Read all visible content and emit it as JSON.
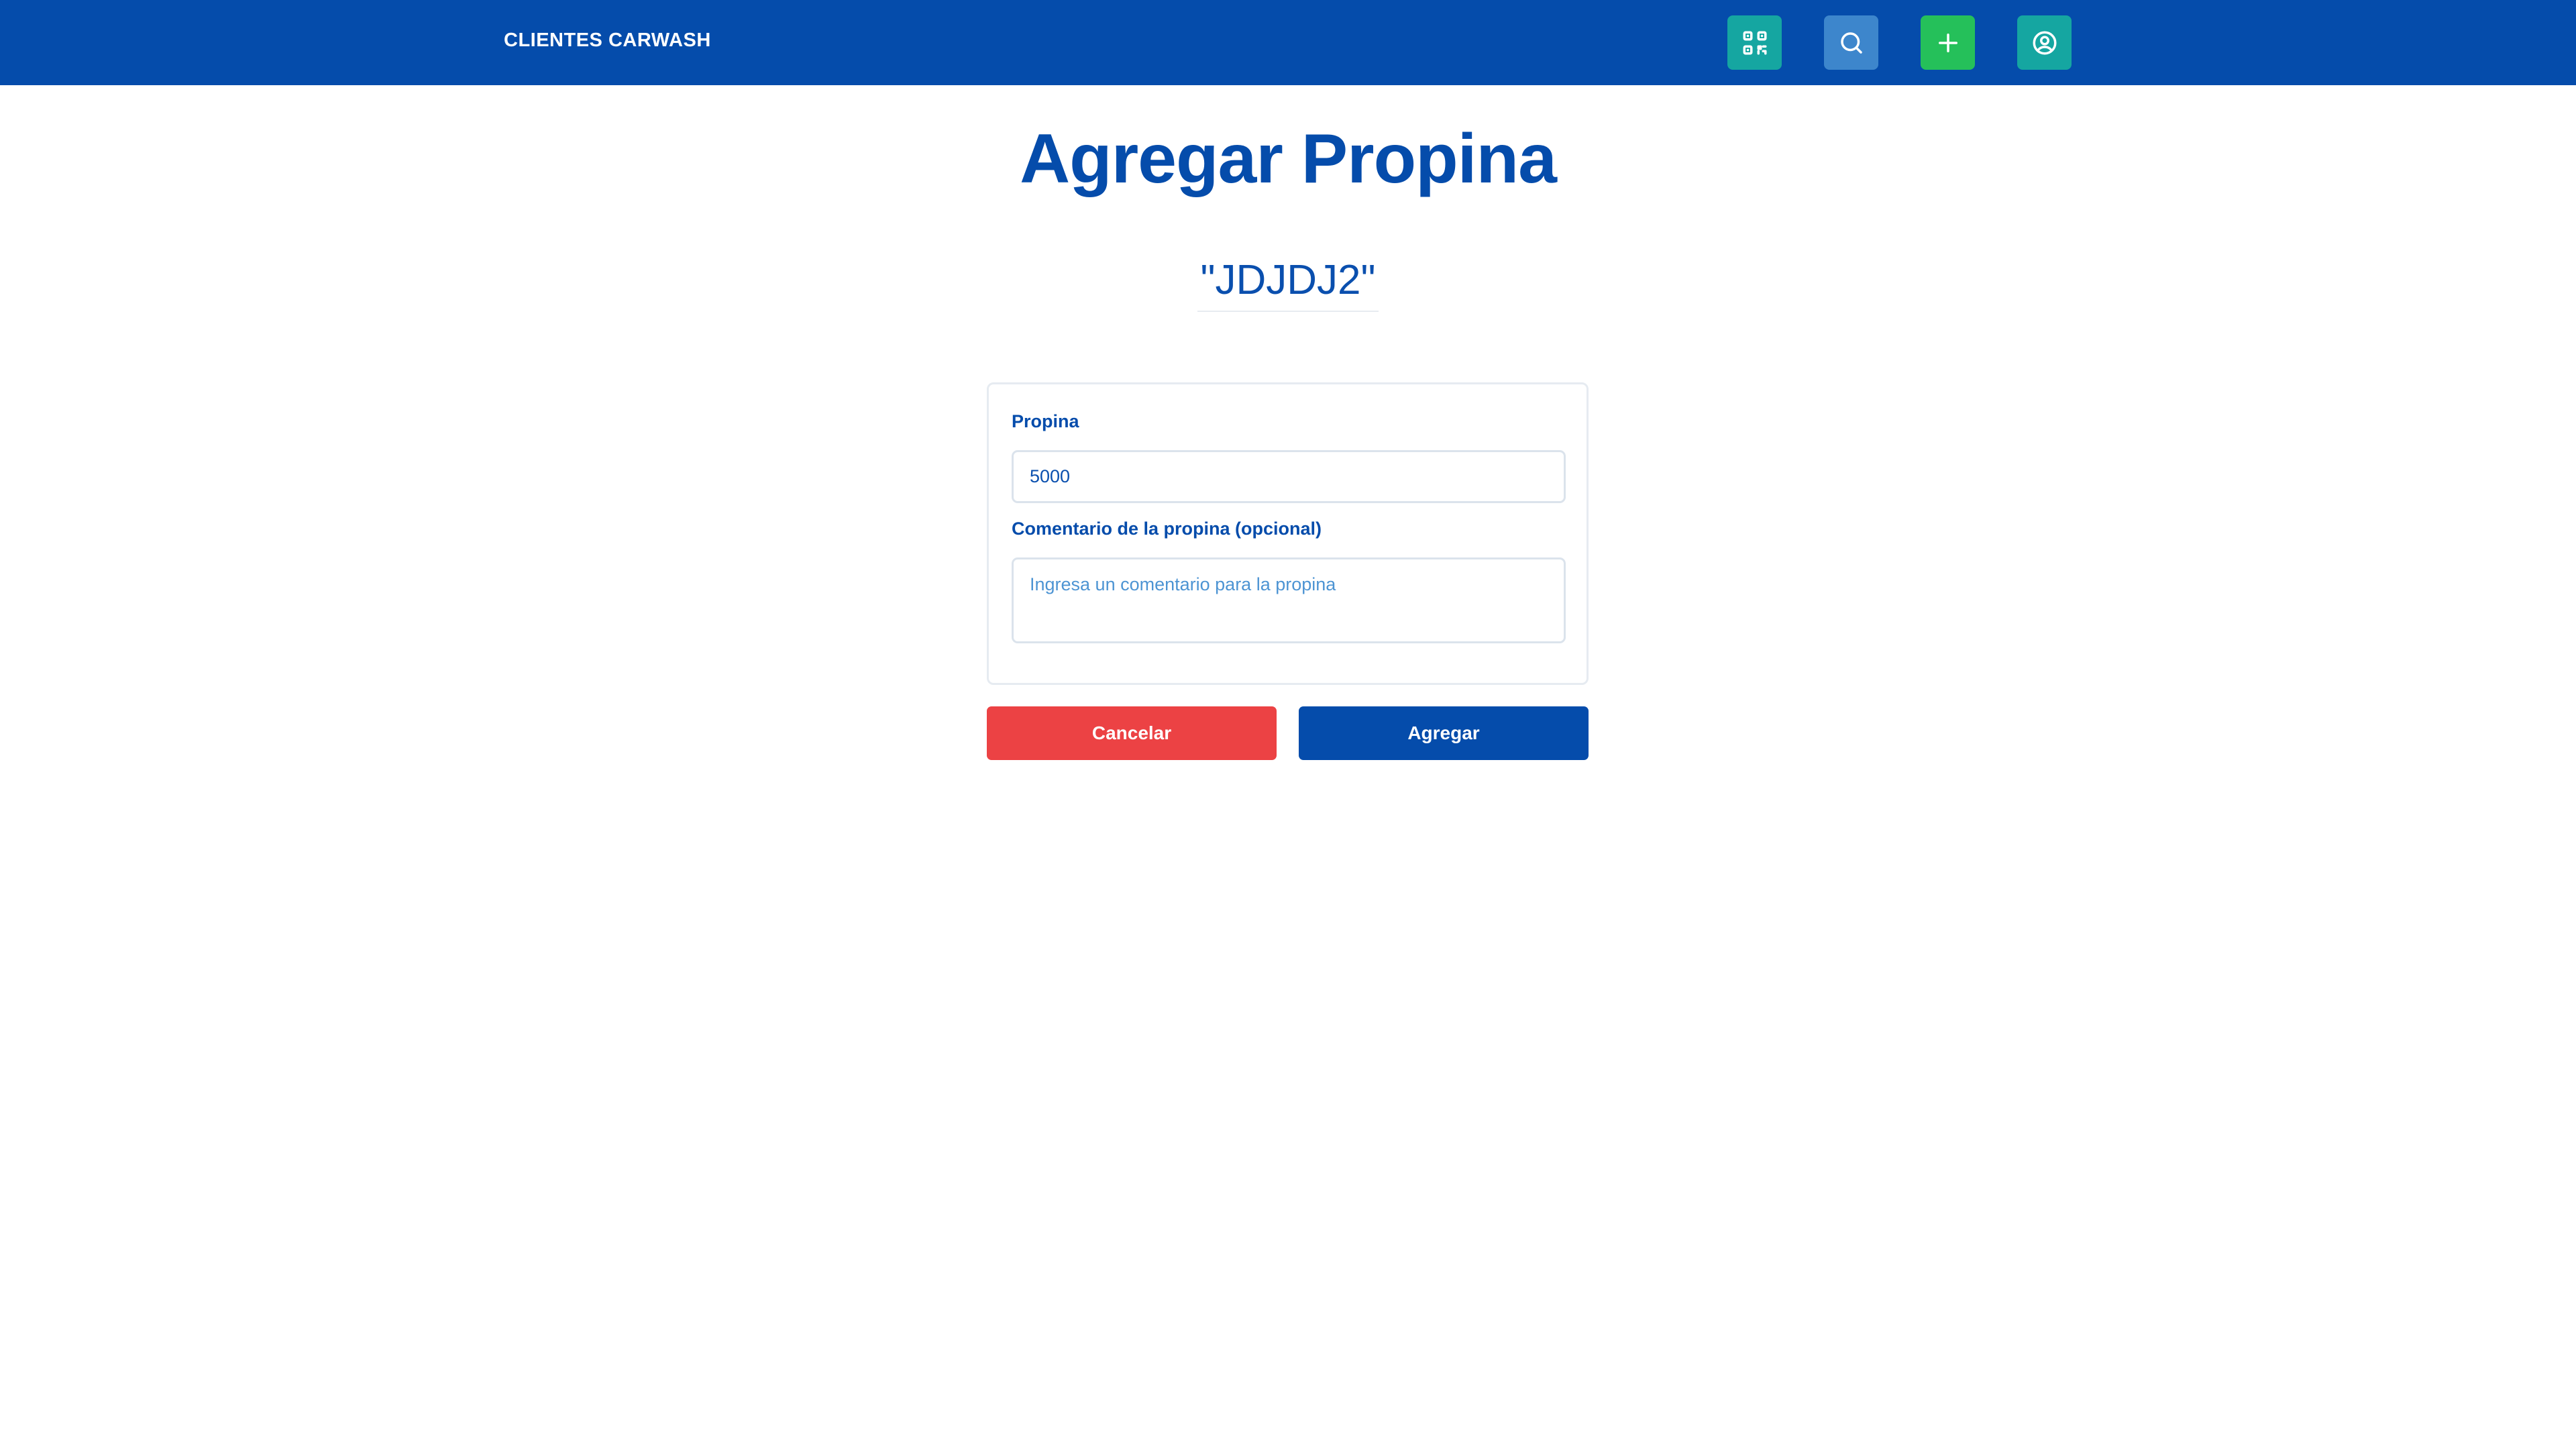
{
  "navbar": {
    "brand": "CLIENTES CARWASH",
    "buttons": [
      {
        "icon": "qr-code-icon",
        "color": "#15a6a1"
      },
      {
        "icon": "search-icon",
        "color": "#3d86cc"
      },
      {
        "icon": "plus-icon",
        "color": "#25c05a"
      },
      {
        "icon": "user-circle-icon",
        "color": "#15a6a1"
      }
    ],
    "background": "#054cab"
  },
  "page": {
    "title": "Agregar Propina",
    "plate": "\"JDJDJ2\""
  },
  "form": {
    "propina_label": "Propina",
    "propina_value": "5000",
    "comentario_label": "Comentario de la propina (opcional)",
    "comentario_value": "",
    "comentario_placeholder": "Ingresa un comentario para la propina"
  },
  "actions": {
    "cancel_label": "Cancelar",
    "cancel_color": "#ec4244",
    "submit_label": "Agregar",
    "submit_color": "#054cab"
  }
}
